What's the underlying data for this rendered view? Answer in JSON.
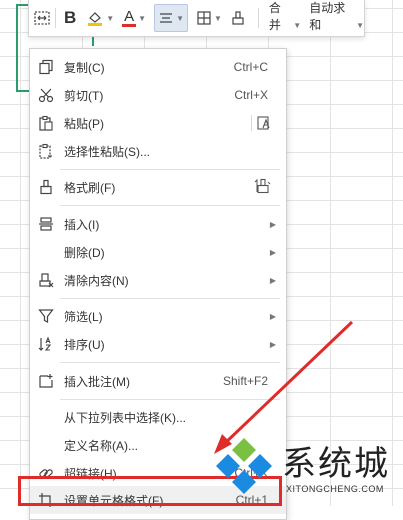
{
  "toolbar": {
    "items": [
      {
        "name": "merge-cells-icon"
      },
      {
        "name": "bold-icon",
        "text": "B"
      },
      {
        "name": "fill-color-icon"
      },
      {
        "name": "font-color-icon",
        "text": "A"
      },
      {
        "name": "align-icon",
        "active": true
      },
      {
        "name": "borders-icon"
      },
      {
        "name": "format-brush-icon"
      }
    ],
    "merge_label": "合并",
    "autosum_label": "自动求和"
  },
  "menu": {
    "items": [
      {
        "label": "复制(C)",
        "shortcut": "Ctrl+C",
        "icon": "copy-icon"
      },
      {
        "label": "剪切(T)",
        "shortcut": "Ctrl+X",
        "icon": "cut-icon"
      },
      {
        "label": "粘贴(P)",
        "icon": "paste-icon"
      },
      {
        "label": "选择性粘贴(S)...",
        "icon": "paste-special-icon"
      },
      {
        "label": "格式刷(F)",
        "icon": "format-painter-icon"
      },
      {
        "label": "插入(I)",
        "icon": "insert-icon",
        "submenu": true
      },
      {
        "label": "删除(D)",
        "submenu": true
      },
      {
        "label": "清除内容(N)",
        "icon": "clear-icon",
        "submenu": true
      },
      {
        "label": "筛选(L)",
        "icon": "filter-icon",
        "submenu": true
      },
      {
        "label": "排序(U)",
        "icon": "sort-icon",
        "submenu": true
      },
      {
        "label": "插入批注(M)",
        "shortcut": "Shift+F2",
        "icon": "comment-icon"
      },
      {
        "label": "从下拉列表中选择(K)..."
      },
      {
        "label": "定义名称(A)..."
      },
      {
        "label": "超链接(H)...",
        "shortcut": "Ctrl+K",
        "icon": "link-icon"
      },
      {
        "label": "设置单元格格式(F)...",
        "shortcut": "Ctrl+1",
        "icon": "format-cells-icon"
      }
    ]
  },
  "watermark": {
    "title": "系统城",
    "url": "XITONGCHENG.COM"
  },
  "colors": {
    "annotation_red": "#e02b2b",
    "selection_green": "#2a9d6a",
    "font_color_red": "#e02b2b",
    "fill_yellow": "#f5c400"
  }
}
